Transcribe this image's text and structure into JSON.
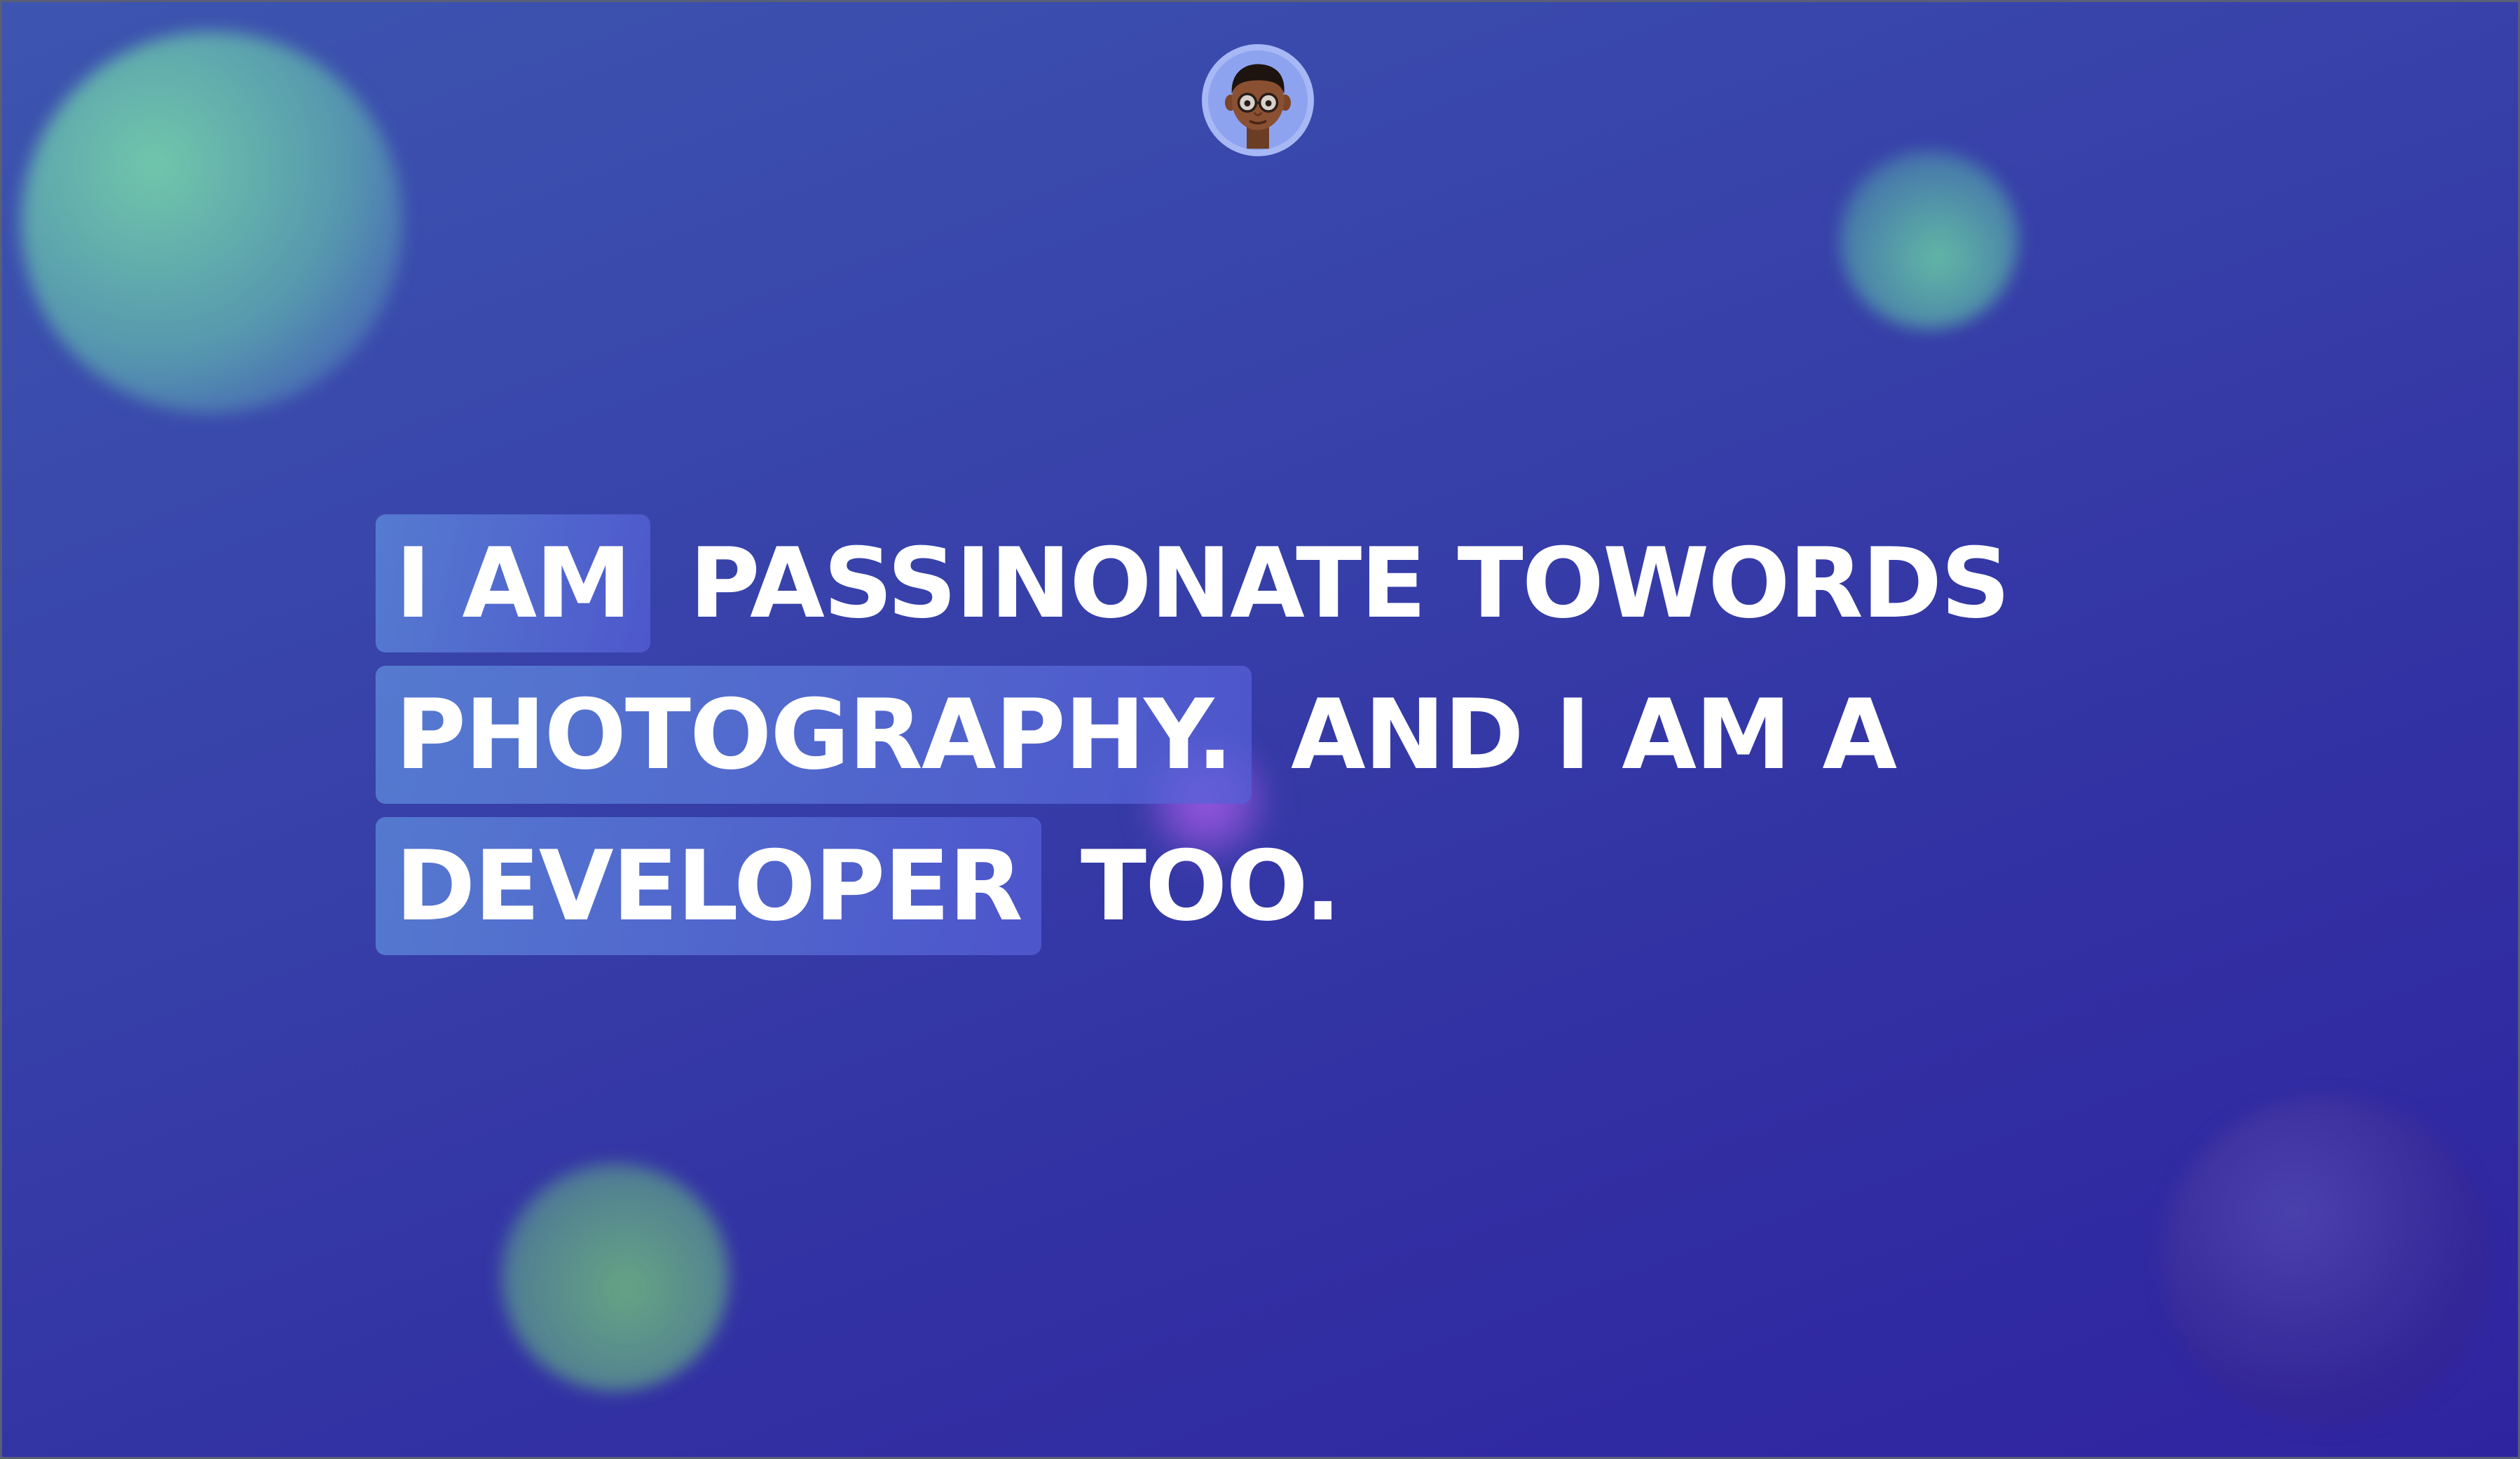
{
  "profile": {
    "avatar_icon": "memoji-avatar-icon"
  },
  "headline": {
    "line1": {
      "highlight": "I AM",
      "rest": "PASSINONATE TOWORDS"
    },
    "line2": {
      "highlight": "PHOTOGRAPHY.",
      "rest": "AND I AM A"
    },
    "line3": {
      "highlight": "DEVELOPER",
      "rest": "TOO."
    }
  },
  "colors": {
    "background_start": "#3d55b0",
    "background_end": "#2f24a0",
    "highlight": "#5f8cdc",
    "text": "#ffffff",
    "blob_green": "#73cdaa",
    "blob_purple": "#3728a0",
    "blob_pink": "#af5feb"
  }
}
